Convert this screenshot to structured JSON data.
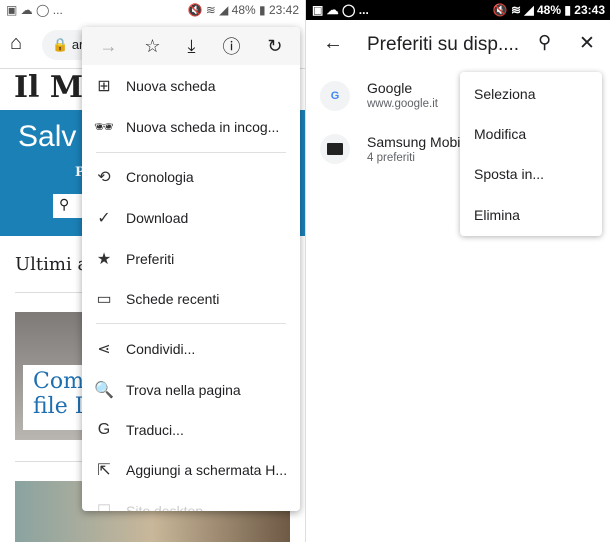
{
  "left": {
    "status": {
      "left_icons": "▣ ☁ ◯ ...",
      "right": "🔇 ≋ ◢ 48% ▮ 23:42"
    },
    "url_partial": "ar",
    "site_logo": "Il M",
    "banner_text": "Salv",
    "banner_sub": "P",
    "section_title": "Ultimi a",
    "article_title_line1": "Com",
    "article_title_line2": "file I",
    "menu": {
      "toolbar": [
        "forward-icon",
        "star-icon",
        "download-icon",
        "info-icon",
        "refresh-icon"
      ],
      "items": [
        {
          "label": "Nuova scheda",
          "icon": "new-tab-icon"
        },
        {
          "label": "Nuova scheda in incog...",
          "icon": "incognito-icon"
        },
        {
          "label": "Cronologia",
          "icon": "history-icon"
        },
        {
          "label": "Download",
          "icon": "download-done-icon"
        },
        {
          "label": "Preferiti",
          "icon": "star-filled-icon"
        },
        {
          "label": "Schede recenti",
          "icon": "devices-icon"
        },
        {
          "label": "Condividi...",
          "icon": "share-icon"
        },
        {
          "label": "Trova nella pagina",
          "icon": "find-in-page-icon"
        },
        {
          "label": "Traduci...",
          "icon": "translate-icon"
        },
        {
          "label": "Aggiungi a schermata H...",
          "icon": "add-to-home-icon"
        },
        {
          "label": "Sito desktop",
          "icon": "desktop-icon"
        }
      ]
    }
  },
  "right": {
    "status": {
      "left_icons": "▣ ☁ ◯ ...",
      "right": "🔇 ≋ ◢ 48% ▮ 23:43"
    },
    "title": "Preferiti su disp....",
    "bookmarks": [
      {
        "title": "Google",
        "subtitle": "www.google.it",
        "icon": "G"
      },
      {
        "title": "Samsung Mobil",
        "subtitle": "4 preferiti",
        "icon": "folder-icon"
      }
    ],
    "context_menu": [
      "Seleziona",
      "Modifica",
      "Sposta in...",
      "Elimina"
    ]
  }
}
